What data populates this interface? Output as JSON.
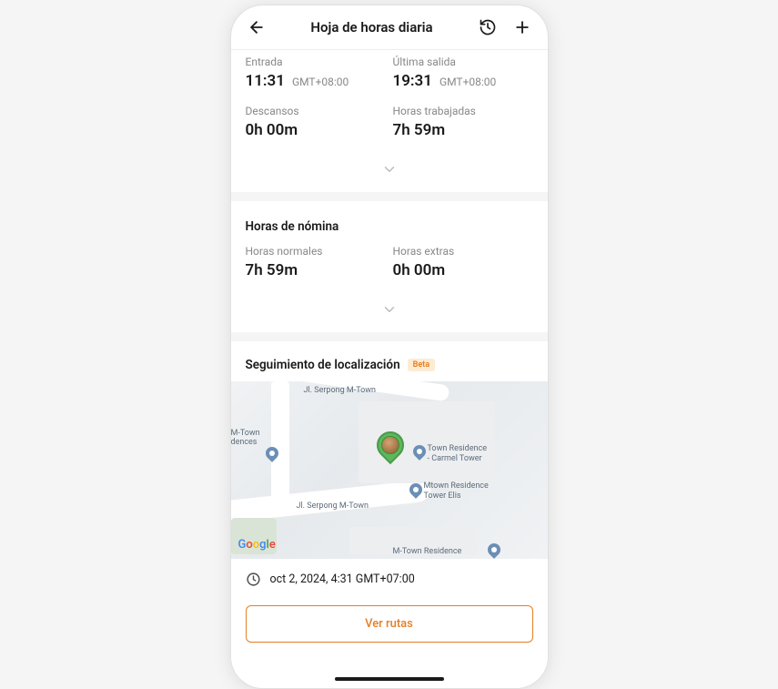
{
  "header": {
    "title": "Hoja de horas diaria"
  },
  "timesheet": {
    "clock_in_label": "Entrada",
    "clock_in_value": "11:31",
    "clock_in_tz": "GMT+08:00",
    "clock_out_label": "Última salida",
    "clock_out_value": "19:31",
    "clock_out_tz": "GMT+08:00",
    "breaks_label": "Descansos",
    "breaks_value": "0h 00m",
    "worked_label": "Horas trabajadas",
    "worked_value": "7h 59m"
  },
  "payroll": {
    "section_title": "Horas de nómina",
    "regular_label": "Horas normales",
    "regular_value": "7h 59m",
    "extra_label": "Horas extras",
    "extra_value": "0h 00m"
  },
  "location": {
    "section_title": "Seguimiento de localización",
    "badge": "Beta",
    "timestamp": "oct 2, 2024, 4:31 GMT+07:00",
    "button": "Ver rutas",
    "map_attribution": "Google",
    "map_labels": {
      "street_top": "Jl. Serpong M-Town",
      "street_mid": "Jl. Serpong M-Town",
      "poi_left1": "M-Town",
      "poi_left2": "dences",
      "poi_right1": "Town Residence",
      "poi_right1b": "- Carmel Tower",
      "poi_right2": "Mtown Residence",
      "poi_right2b": "Tower Elis",
      "poi_bottom": "M-Town Residence"
    }
  }
}
